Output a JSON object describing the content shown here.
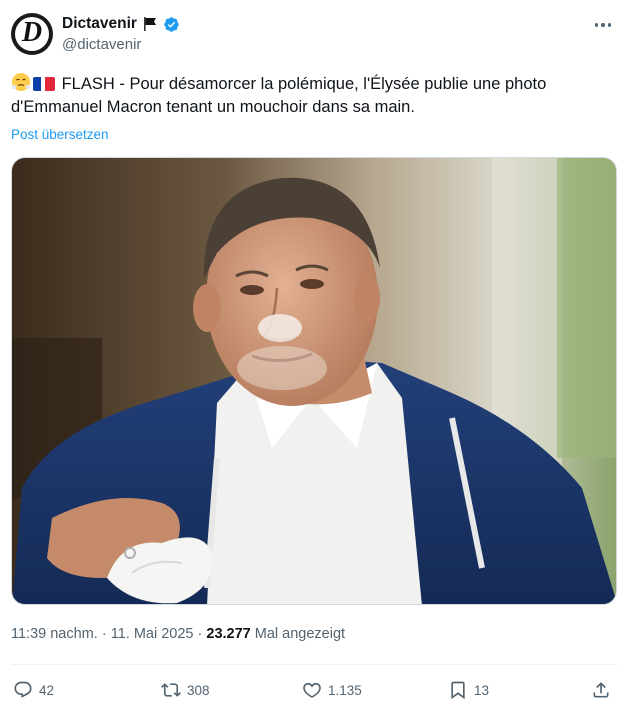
{
  "author": {
    "display_name": "Dictavenir",
    "handle": "@dictavenir",
    "avatar_letter": "D",
    "verified": true
  },
  "tweet": {
    "emojis": [
      "face-with-steam-emoji",
      "french-flag-emoji"
    ],
    "text_line1": "FLASH - Pour désamorcer la polémique, l'Élysée publie une photo",
    "text_line2": "d'Emmanuel Macron tenant un mouchoir dans sa main.",
    "translate_label": "Post übersetzen"
  },
  "meta": {
    "time": "11:39 nachm.",
    "separator": "·",
    "date": "11. Mai 2025",
    "views_count": "23.277",
    "views_label": "Mal angezeigt"
  },
  "actions": {
    "replies": "42",
    "reposts": "308",
    "likes": "1.135",
    "bookmarks": "13"
  },
  "colors": {
    "accent": "#1d9bf0",
    "text_secondary": "#536471",
    "text_primary": "#0f1419"
  }
}
